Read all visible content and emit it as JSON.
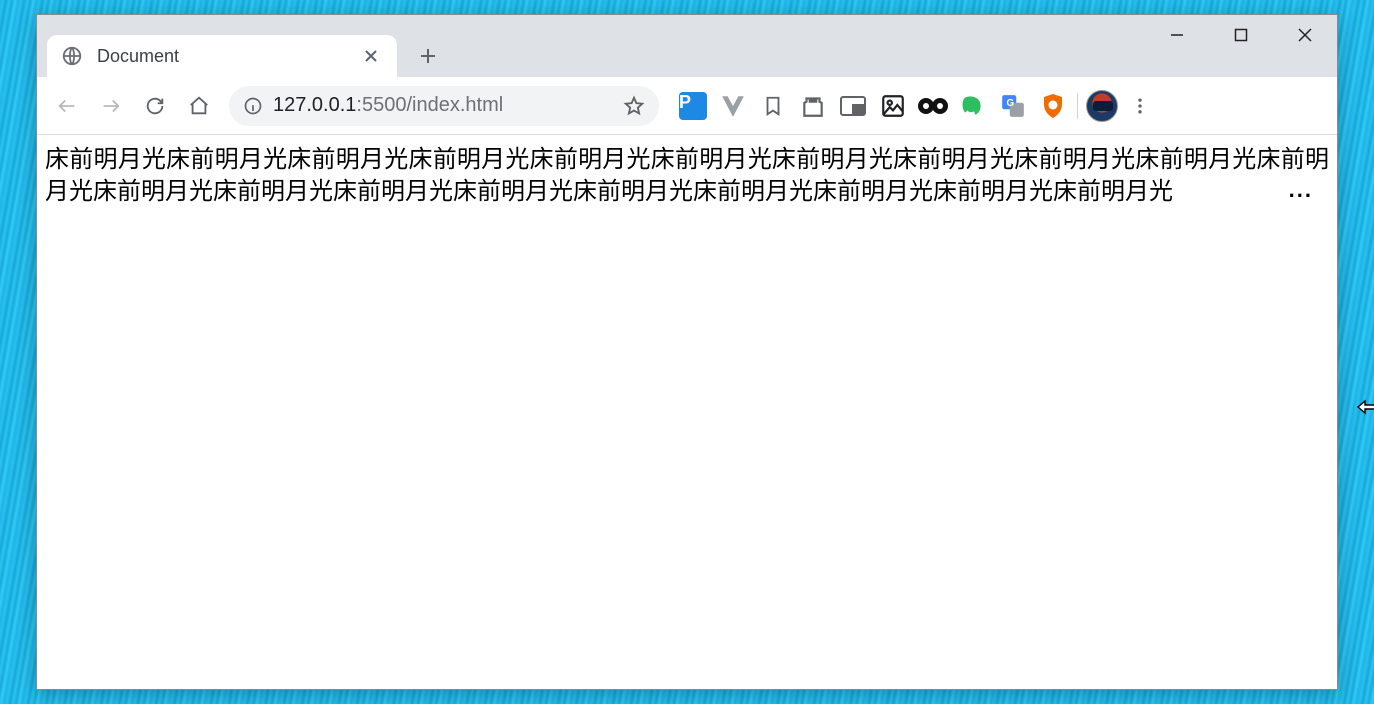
{
  "window": {
    "controls": {
      "minimize": "minimize",
      "maximize": "maximize",
      "close": "close"
    }
  },
  "tabs": {
    "active": {
      "title": "Document",
      "favicon": "globe-icon"
    },
    "new_tab_label": "+"
  },
  "nav": {
    "back": "back",
    "forward": "forward",
    "reload": "reload",
    "home": "home"
  },
  "omnibox": {
    "info_icon": "info-icon",
    "url_host": "127.0.0.1",
    "url_port": ":5500",
    "url_path": "/index.html",
    "star_icon": "star-icon"
  },
  "extensions": [
    {
      "name": "postman-icon",
      "kind": "letter",
      "letter": "P",
      "bg": "#1e88e5"
    },
    {
      "name": "vue-icon",
      "kind": "vue"
    },
    {
      "name": "bookmark-icon",
      "kind": "bookmark"
    },
    {
      "name": "castle-icon",
      "kind": "castle"
    },
    {
      "name": "pip-icon",
      "kind": "pip"
    },
    {
      "name": "photo-icon",
      "kind": "photo"
    },
    {
      "name": "eyes-icon",
      "kind": "eyes"
    },
    {
      "name": "evernote-icon",
      "kind": "elephant"
    },
    {
      "name": "gtranslate-icon",
      "kind": "gtrans"
    },
    {
      "name": "shield-icon",
      "kind": "shield"
    }
  ],
  "avatar": {
    "name": "profile-avatar"
  },
  "menu": {
    "name": "kebab-menu"
  },
  "page": {
    "body_text": "床前明月光床前明月光床前明月光床前明月光床前明月光床前明月光床前明月光床前明月光床前明月光床前明月光床前明月光床前明月光床前明月光床前明月光床前明月光床前明月光床前明月光床前明月光床前明月光床前明月光",
    "ellipsis": "..."
  }
}
